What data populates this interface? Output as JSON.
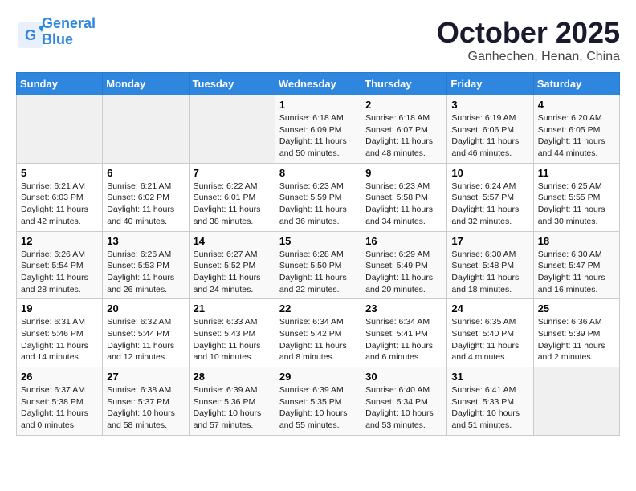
{
  "logo": {
    "line1": "General",
    "line2": "Blue"
  },
  "title": "October 2025",
  "location": "Ganhechen, Henan, China",
  "headers": [
    "Sunday",
    "Monday",
    "Tuesday",
    "Wednesday",
    "Thursday",
    "Friday",
    "Saturday"
  ],
  "weeks": [
    [
      {
        "day": "",
        "info": ""
      },
      {
        "day": "",
        "info": ""
      },
      {
        "day": "",
        "info": ""
      },
      {
        "day": "1",
        "info": "Sunrise: 6:18 AM\nSunset: 6:09 PM\nDaylight: 11 hours\nand 50 minutes."
      },
      {
        "day": "2",
        "info": "Sunrise: 6:18 AM\nSunset: 6:07 PM\nDaylight: 11 hours\nand 48 minutes."
      },
      {
        "day": "3",
        "info": "Sunrise: 6:19 AM\nSunset: 6:06 PM\nDaylight: 11 hours\nand 46 minutes."
      },
      {
        "day": "4",
        "info": "Sunrise: 6:20 AM\nSunset: 6:05 PM\nDaylight: 11 hours\nand 44 minutes."
      }
    ],
    [
      {
        "day": "5",
        "info": "Sunrise: 6:21 AM\nSunset: 6:03 PM\nDaylight: 11 hours\nand 42 minutes."
      },
      {
        "day": "6",
        "info": "Sunrise: 6:21 AM\nSunset: 6:02 PM\nDaylight: 11 hours\nand 40 minutes."
      },
      {
        "day": "7",
        "info": "Sunrise: 6:22 AM\nSunset: 6:01 PM\nDaylight: 11 hours\nand 38 minutes."
      },
      {
        "day": "8",
        "info": "Sunrise: 6:23 AM\nSunset: 5:59 PM\nDaylight: 11 hours\nand 36 minutes."
      },
      {
        "day": "9",
        "info": "Sunrise: 6:23 AM\nSunset: 5:58 PM\nDaylight: 11 hours\nand 34 minutes."
      },
      {
        "day": "10",
        "info": "Sunrise: 6:24 AM\nSunset: 5:57 PM\nDaylight: 11 hours\nand 32 minutes."
      },
      {
        "day": "11",
        "info": "Sunrise: 6:25 AM\nSunset: 5:55 PM\nDaylight: 11 hours\nand 30 minutes."
      }
    ],
    [
      {
        "day": "12",
        "info": "Sunrise: 6:26 AM\nSunset: 5:54 PM\nDaylight: 11 hours\nand 28 minutes."
      },
      {
        "day": "13",
        "info": "Sunrise: 6:26 AM\nSunset: 5:53 PM\nDaylight: 11 hours\nand 26 minutes."
      },
      {
        "day": "14",
        "info": "Sunrise: 6:27 AM\nSunset: 5:52 PM\nDaylight: 11 hours\nand 24 minutes."
      },
      {
        "day": "15",
        "info": "Sunrise: 6:28 AM\nSunset: 5:50 PM\nDaylight: 11 hours\nand 22 minutes."
      },
      {
        "day": "16",
        "info": "Sunrise: 6:29 AM\nSunset: 5:49 PM\nDaylight: 11 hours\nand 20 minutes."
      },
      {
        "day": "17",
        "info": "Sunrise: 6:30 AM\nSunset: 5:48 PM\nDaylight: 11 hours\nand 18 minutes."
      },
      {
        "day": "18",
        "info": "Sunrise: 6:30 AM\nSunset: 5:47 PM\nDaylight: 11 hours\nand 16 minutes."
      }
    ],
    [
      {
        "day": "19",
        "info": "Sunrise: 6:31 AM\nSunset: 5:46 PM\nDaylight: 11 hours\nand 14 minutes."
      },
      {
        "day": "20",
        "info": "Sunrise: 6:32 AM\nSunset: 5:44 PM\nDaylight: 11 hours\nand 12 minutes."
      },
      {
        "day": "21",
        "info": "Sunrise: 6:33 AM\nSunset: 5:43 PM\nDaylight: 11 hours\nand 10 minutes."
      },
      {
        "day": "22",
        "info": "Sunrise: 6:34 AM\nSunset: 5:42 PM\nDaylight: 11 hours\nand 8 minutes."
      },
      {
        "day": "23",
        "info": "Sunrise: 6:34 AM\nSunset: 5:41 PM\nDaylight: 11 hours\nand 6 minutes."
      },
      {
        "day": "24",
        "info": "Sunrise: 6:35 AM\nSunset: 5:40 PM\nDaylight: 11 hours\nand 4 minutes."
      },
      {
        "day": "25",
        "info": "Sunrise: 6:36 AM\nSunset: 5:39 PM\nDaylight: 11 hours\nand 2 minutes."
      }
    ],
    [
      {
        "day": "26",
        "info": "Sunrise: 6:37 AM\nSunset: 5:38 PM\nDaylight: 11 hours\nand 0 minutes."
      },
      {
        "day": "27",
        "info": "Sunrise: 6:38 AM\nSunset: 5:37 PM\nDaylight: 10 hours\nand 58 minutes."
      },
      {
        "day": "28",
        "info": "Sunrise: 6:39 AM\nSunset: 5:36 PM\nDaylight: 10 hours\nand 57 minutes."
      },
      {
        "day": "29",
        "info": "Sunrise: 6:39 AM\nSunset: 5:35 PM\nDaylight: 10 hours\nand 55 minutes."
      },
      {
        "day": "30",
        "info": "Sunrise: 6:40 AM\nSunset: 5:34 PM\nDaylight: 10 hours\nand 53 minutes."
      },
      {
        "day": "31",
        "info": "Sunrise: 6:41 AM\nSunset: 5:33 PM\nDaylight: 10 hours\nand 51 minutes."
      },
      {
        "day": "",
        "info": ""
      }
    ]
  ]
}
